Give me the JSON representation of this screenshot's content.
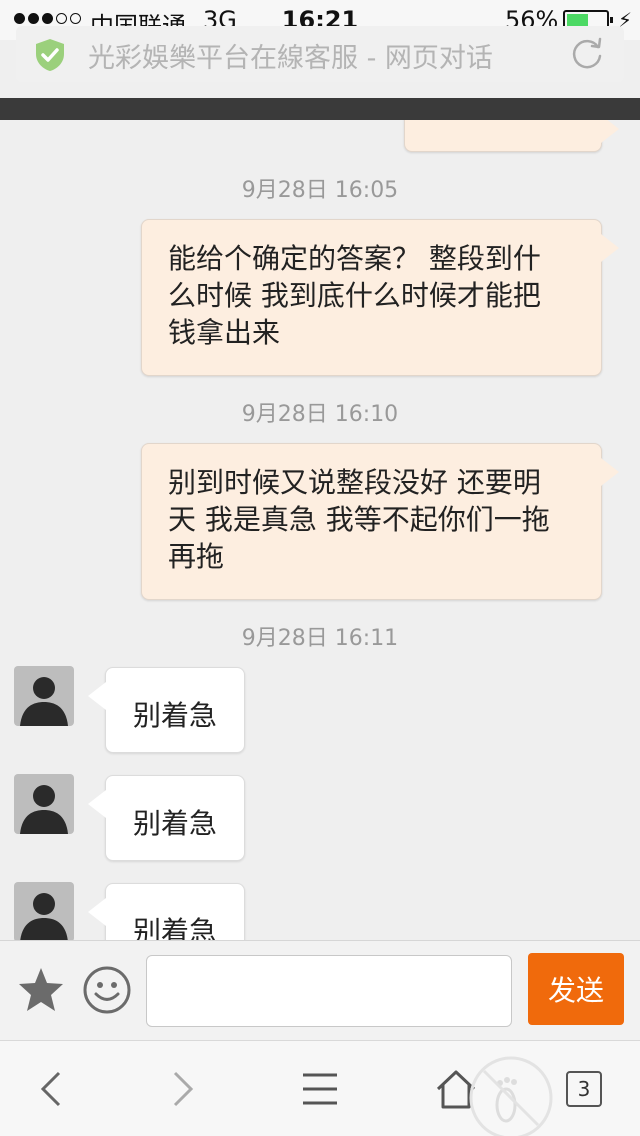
{
  "status_bar": {
    "carrier": "中国联通",
    "network": "3G",
    "time": "16:21",
    "battery_percent": "56%",
    "battery_level": 0.56
  },
  "browser": {
    "page_title": "光彩娛樂平台在線客服 - 网页对话",
    "secure_icon": "shield-check-icon",
    "reload_icon": "reload-icon",
    "accent_green": "#9bd07c"
  },
  "chat": {
    "timestamps": [
      "9月28日 16:05",
      "9月28日 16:10",
      "9月28日 16:11"
    ],
    "outgoing": [
      {
        "lines": [
          "能给个确定的答案？ 整段到什",
          "么时候 我到底什么时候才能把",
          "钱拿出来"
        ]
      },
      {
        "lines": [
          "别到时候又说整段没好 还要明",
          "天 我是真急 我等不起你们一拖",
          "再拖"
        ]
      }
    ],
    "incoming": [
      {
        "text": "别着急"
      },
      {
        "text": "别着急"
      },
      {
        "text": "别着急"
      }
    ],
    "outgoing_bubble_color": "#fdeee0",
    "incoming_bubble_color": "#ffffff"
  },
  "input_bar": {
    "message_value": "",
    "message_placeholder": "",
    "send_label": "发送",
    "send_color": "#f06a0c"
  },
  "toolbar": {
    "tab_count": "3"
  }
}
